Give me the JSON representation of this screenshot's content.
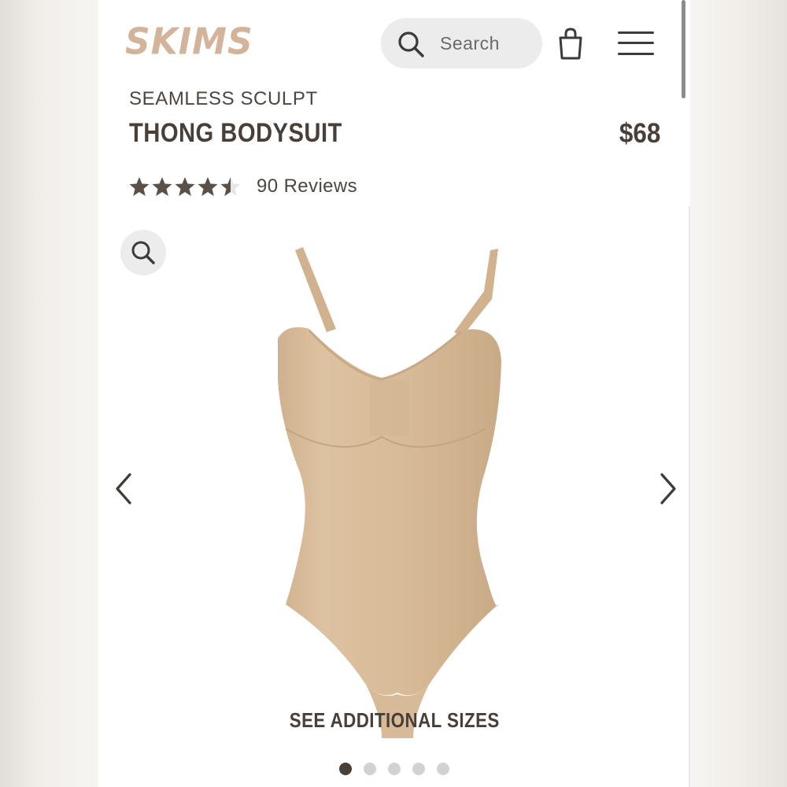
{
  "header": {
    "logo_text": "SKIMS",
    "search_placeholder": "Search"
  },
  "product": {
    "collection": "SEAMLESS SCULPT",
    "name": "THONG BODYSUIT",
    "price": "$68",
    "rating": 4.5,
    "reviews_label": "90 Reviews",
    "color_hex": "#d9bd9b"
  },
  "gallery": {
    "see_sizes_label": "SEE ADDITIONAL SIZES",
    "image_count": 5,
    "active_index": 0
  },
  "colors": {
    "logo": "#d3b49a",
    "text_dark": "#4a3f36",
    "pill_bg": "#ececec"
  }
}
